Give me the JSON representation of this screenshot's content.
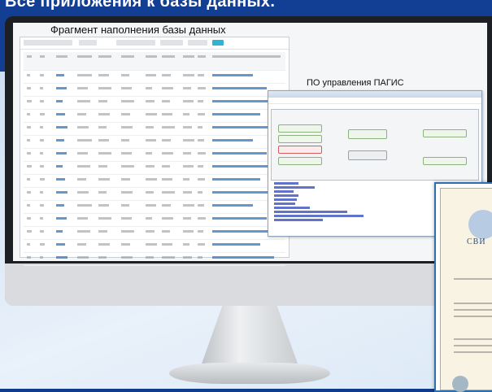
{
  "page": {
    "heading": "Все приложения к базы данных."
  },
  "screen": {
    "db_title": "Фрагмент наполнения базы данных",
    "pagis_title": "ПО управления ПАГИС"
  },
  "certificate": {
    "headline": "СВИ"
  },
  "colors": {
    "header_band": "#123f93",
    "monitor_bezel": "#1c1f24",
    "monitor_chin": "#d9dbde",
    "table_link": "#3d7fc0",
    "window_green_button": "#8fb17f",
    "window_red_button": "#d45c5c",
    "log_text": "#2d44b8",
    "certificate_border": "#2f6fb0"
  }
}
